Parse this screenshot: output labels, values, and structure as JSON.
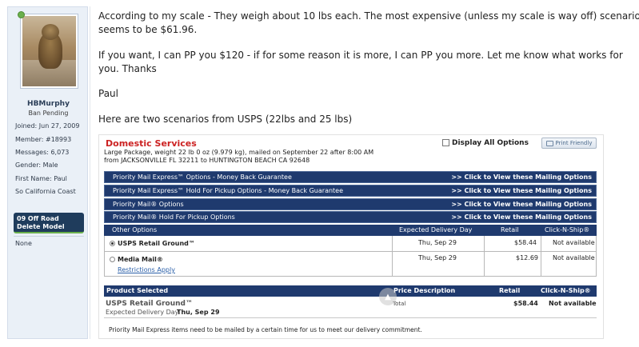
{
  "sidebar": {
    "username": "HBMurphy",
    "user_title": "Ban Pending",
    "joined": "Joined:  Jun 27, 2009",
    "member": "Member:  #18993",
    "messages": "Messages:  6,073",
    "gender": "Gender:  Male",
    "first_name": "First Name:  Paul",
    "location": "So California Coast",
    "badge": "09 Off Road Delete Model",
    "none": "None"
  },
  "message": {
    "line1": "According to my scale - They weigh about 10 lbs each. The most expensive (unless my scale is way off) scenario",
    "line2": "seems to be $61.96.",
    "line3": "If you want, I can PP you $120 - if for some reason it is more, I can PP you more. Let me know what works for",
    "line4": "you. Thanks",
    "line5": "Paul",
    "line6": "Here are two scenarios from USPS (22lbs and 25 lbs)"
  },
  "usps": {
    "title": "Domestic Services",
    "desc1": "Large Package, weight 22 lb 0 oz (9.979 kg), mailed on September 22 after 8:00 AM",
    "desc2": "from JACKSONVILLE FL 32211 to HUNTINGTON BEACH CA 92648",
    "display_all": "Display All Options",
    "print_friendly": "Print Friendly",
    "bands": [
      {
        "label": "Priority Mail Express™ Options - Money Back Guarantee",
        "link": ">> Click to View these Mailing Options"
      },
      {
        "label": "Priority Mail Express™ Hold For Pickup Options - Money Back Guarantee",
        "link": ">> Click to View these Mailing Options"
      },
      {
        "label": "Priority Mail® Options",
        "link": ">> Click to View these Mailing Options"
      },
      {
        "label": "Priority Mail® Hold For Pickup Options",
        "link": ">> Click to View these Mailing Options"
      }
    ],
    "columns": {
      "other_options": "Other Options",
      "delivery_day": "Expected Delivery Day",
      "retail": "Retail",
      "click_n_ship": "Click-N-Ship®"
    },
    "options": [
      {
        "name": "USPS Retail Ground™",
        "day": "Thu, Sep 29",
        "retail": "$58.44",
        "cns": "Not available"
      },
      {
        "name": "Media Mail®",
        "day": "Thu, Sep 29",
        "retail": "$12.69",
        "cns": "Not available",
        "note": "Restrictions Apply"
      }
    ],
    "selected_header": {
      "product": "Product Selected",
      "price_desc": "Price Description",
      "retail": "Retail",
      "cns": "Click-N-Ship®"
    },
    "selected": {
      "name": "USPS Retail Ground™",
      "edd_label": "Expected Delivery Day",
      "edd_value": "Thu, Sep 29",
      "price_desc": "Total",
      "retail": "$58.44",
      "cns": "Not available"
    },
    "footnote": "Priority Mail Express items need to be mailed by a certain time for us to meet our delivery commitment."
  }
}
